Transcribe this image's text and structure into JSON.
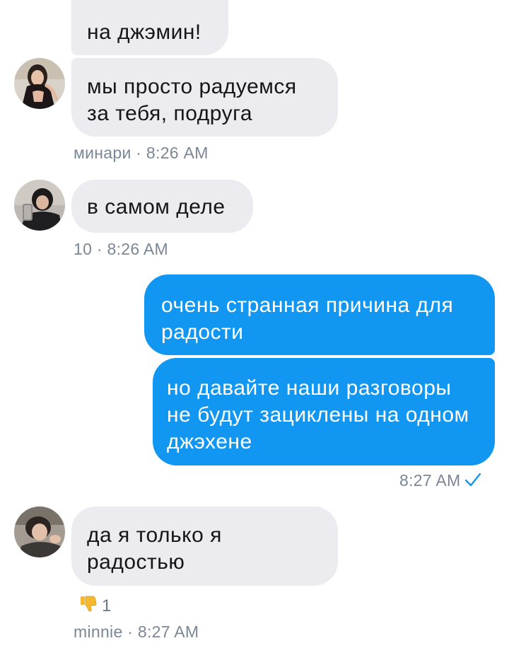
{
  "colors": {
    "incoming_bubble": "#ebebf0",
    "outgoing_bubble": "#1197f2",
    "meta_text": "#7a8797",
    "read_check": "#1197f2"
  },
  "messages": [
    {
      "direction": "incoming",
      "text": "на джэмин!"
    },
    {
      "direction": "incoming",
      "text": "мы просто радуемся за тебя, подруга",
      "meta": "минари · 8:26 AM",
      "avatar": "avatar-girl-icon"
    },
    {
      "direction": "incoming",
      "text": "в самом деле",
      "meta": "10 · 8:26 AM",
      "avatar": "avatar-boy-mirror-icon"
    },
    {
      "direction": "outgoing",
      "text": "очень странная причина для радости"
    },
    {
      "direction": "outgoing",
      "text": "но давайте наши разговоры не будут зациклены на одном джэхене",
      "meta": "8:27 AM",
      "status_icon": "read-check-icon"
    },
    {
      "direction": "incoming",
      "text": "да я только я радостью",
      "meta": "minnie · 8:27 AM",
      "avatar": "avatar-sleeping-boy-icon",
      "reaction": {
        "icon": "thumbs-down-icon",
        "count": "1"
      }
    }
  ]
}
